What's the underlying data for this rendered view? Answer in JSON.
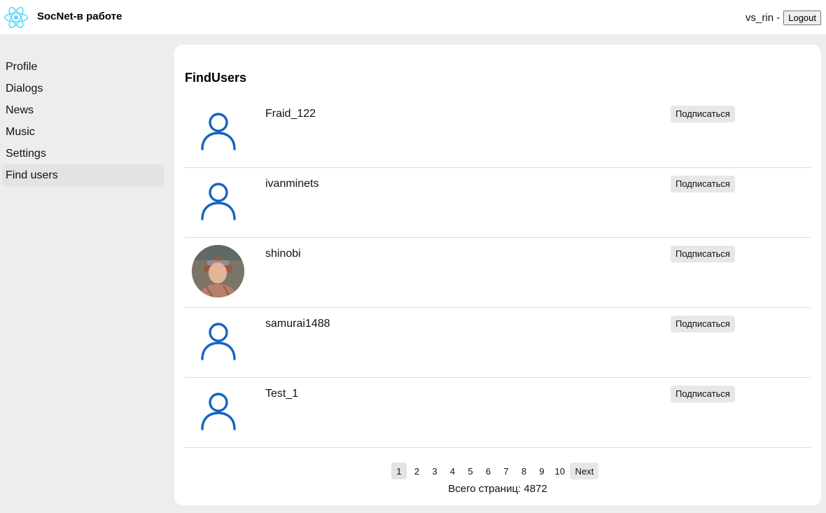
{
  "header": {
    "app_title": "SocNet-в работе",
    "user_label": "vs_rin -",
    "logout_label": "Logout",
    "logo_icon": "react-atom-icon",
    "logo_color": "#61dafb"
  },
  "sidebar": {
    "items": [
      {
        "label": "Profile"
      },
      {
        "label": "Dialogs"
      },
      {
        "label": "News"
      },
      {
        "label": "Music"
      },
      {
        "label": "Settings"
      },
      {
        "label": "Find users",
        "active": true
      }
    ]
  },
  "main": {
    "title": "FindUsers",
    "users": [
      {
        "name": "Fraid_122",
        "avatar": "default-user-icon",
        "follow_label": "Подписаться"
      },
      {
        "name": "ivanminets",
        "avatar": "default-user-icon",
        "follow_label": "Подписаться"
      },
      {
        "name": "shinobi",
        "avatar": "photo",
        "follow_label": "Подписаться"
      },
      {
        "name": "samurai1488",
        "avatar": "default-user-icon",
        "follow_label": "Подписаться"
      },
      {
        "name": "Test_1",
        "avatar": "default-user-icon",
        "follow_label": "Подписаться"
      }
    ],
    "pagination": {
      "pages": [
        "1",
        "2",
        "3",
        "4",
        "5",
        "6",
        "7",
        "8",
        "9",
        "10"
      ],
      "current": "1",
      "next_label": "Next",
      "total_text": "Всего страниц: 4872"
    },
    "colors": {
      "user_icon": "#1565c0"
    }
  }
}
